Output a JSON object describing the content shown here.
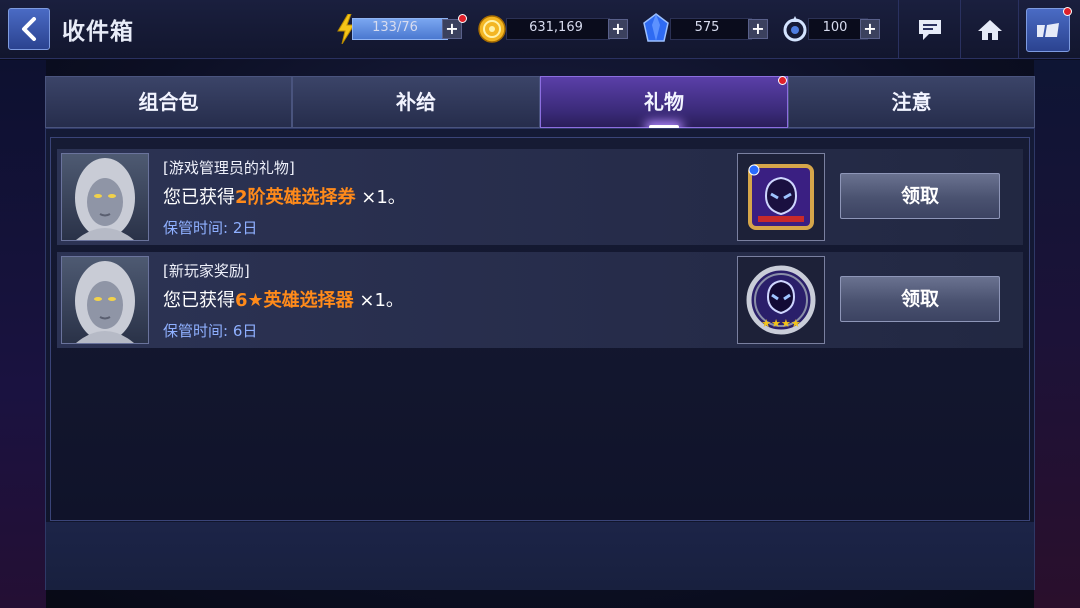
{
  "header": {
    "title": "收件箱",
    "energy": "133/76",
    "gold": "631,169",
    "crystal": "575",
    "points": "100"
  },
  "tabs": [
    {
      "label": "组合包"
    },
    {
      "label": "补给"
    },
    {
      "label": "礼物"
    },
    {
      "label": "注意"
    }
  ],
  "mails": [
    {
      "title": "[游戏管理员的礼物]",
      "msg_prefix": "您已获得",
      "item": "2阶英雄选择券",
      "qty": " ×1。",
      "time": "保管时间: 2日",
      "button": "领取"
    },
    {
      "title": "[新玩家奖励]",
      "msg_prefix": "您已获得",
      "item": "6★英雄选择器",
      "qty": " ×1。",
      "time": "保管时间: 6日",
      "button": "领取"
    }
  ],
  "colors": {
    "highlight": "#ff8a1a",
    "time": "#8fb0ff",
    "accent": "#4a6bc4"
  }
}
